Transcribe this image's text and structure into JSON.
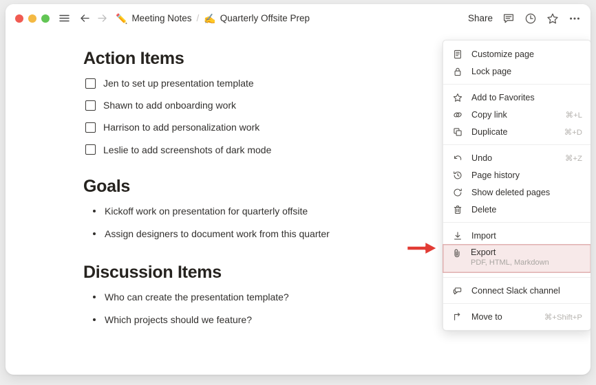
{
  "window": {
    "traffic_lights": [
      "close",
      "minimize",
      "maximize"
    ],
    "colors": {
      "close": "#f05b52",
      "minimize": "#f4b943",
      "maximize": "#62c554",
      "highlight_bg": "#f7e9e9",
      "highlight_border": "#e0b0b0",
      "annotation_arrow": "#e23b34",
      "text": "#32302e",
      "background": "#ededed"
    }
  },
  "titlebar": {
    "menu_icon": "hamburger-icon",
    "back_icon": "arrow-left-icon",
    "forward_icon": "arrow-right-icon",
    "breadcrumb": [
      {
        "emoji": "✏️",
        "label": "Meeting Notes"
      },
      {
        "emoji": "✍️",
        "label": "Quarterly Offsite Prep"
      }
    ],
    "separator": "/",
    "share_label": "Share",
    "right_icons": [
      {
        "name": "comment-icon"
      },
      {
        "name": "clock-icon"
      },
      {
        "name": "star-icon"
      },
      {
        "name": "more-options-icon"
      }
    ]
  },
  "document": {
    "sections": [
      {
        "heading": "Action Items",
        "list_type": "todo",
        "items": [
          "Jen to set up presentation template",
          "Shawn to add onboarding work",
          "Harrison to add personalization work",
          "Leslie to add screenshots of dark mode"
        ]
      },
      {
        "heading": "Goals",
        "list_type": "bullet",
        "items": [
          "Kickoff work on presentation for quarterly offsite",
          "Assign designers to document work from this quarter"
        ]
      },
      {
        "heading": "Discussion Items",
        "list_type": "bullet",
        "items": [
          "Who can create the presentation template?",
          "Which projects should we feature?"
        ]
      }
    ]
  },
  "context_menu": {
    "groups": [
      {
        "items": [
          {
            "icon": "page-icon",
            "label": "Customize page",
            "shortcut": ""
          },
          {
            "icon": "lock-icon",
            "label": "Lock page",
            "shortcut": ""
          }
        ]
      },
      {
        "items": [
          {
            "icon": "star-icon",
            "label": "Add to Favorites",
            "shortcut": ""
          },
          {
            "icon": "link-icon",
            "label": "Copy link",
            "shortcut": "⌘+L"
          },
          {
            "icon": "duplicate-icon",
            "label": "Duplicate",
            "shortcut": "⌘+D"
          }
        ]
      },
      {
        "items": [
          {
            "icon": "undo-icon",
            "label": "Undo",
            "shortcut": "⌘+Z"
          },
          {
            "icon": "history-icon",
            "label": "Page history",
            "shortcut": ""
          },
          {
            "icon": "restore-icon",
            "label": "Show deleted pages",
            "shortcut": ""
          },
          {
            "icon": "trash-icon",
            "label": "Delete",
            "shortcut": ""
          }
        ]
      },
      {
        "items": [
          {
            "icon": "import-icon",
            "label": "Import",
            "shortcut": ""
          },
          {
            "icon": "paperclip-icon",
            "label": "Export",
            "shortcut": "",
            "sublabel": "PDF, HTML, Markdown",
            "highlighted": true
          }
        ]
      },
      {
        "items": [
          {
            "icon": "slack-icon",
            "label": "Connect Slack channel",
            "shortcut": ""
          }
        ]
      },
      {
        "items": [
          {
            "icon": "move-to-icon",
            "label": "Move to",
            "shortcut": "⌘+Shift+P"
          }
        ]
      }
    ]
  },
  "annotation": {
    "arrow": "right-arrow-annotation",
    "points_to": "Export"
  }
}
